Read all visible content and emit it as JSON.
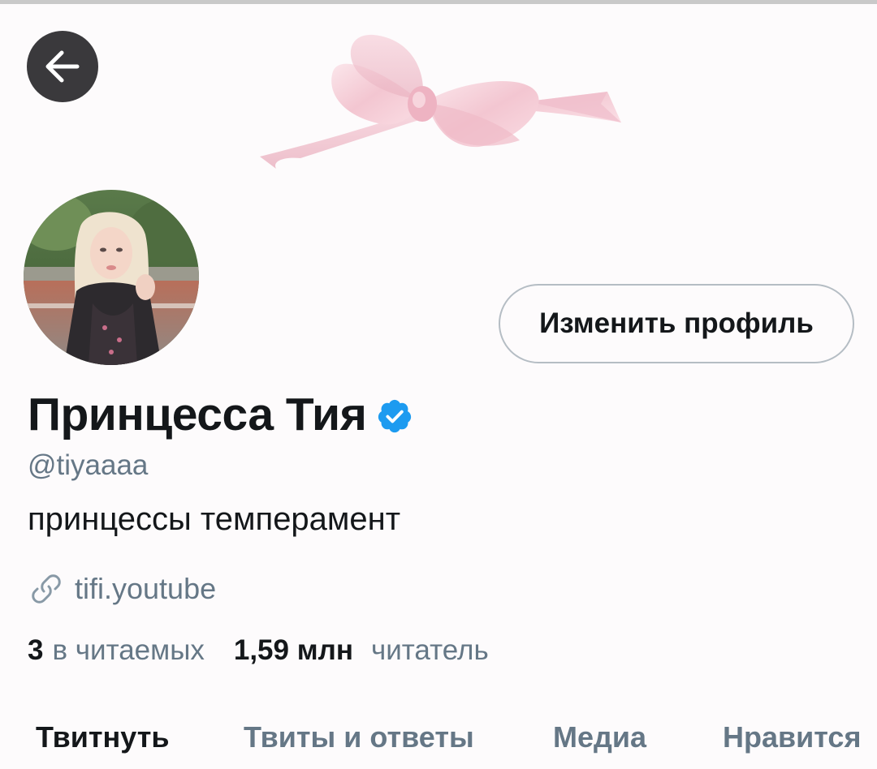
{
  "header": {
    "back_icon": "arrow-left-icon"
  },
  "profile": {
    "display_name": "Принцесса Тия",
    "verified_icon": "verified-badge-icon",
    "handle": "@tiyaaaa",
    "bio": "принцессы темперамент",
    "link_icon": "link-icon",
    "link": "tifi.youtube",
    "edit_button_label": "Изменить профиль"
  },
  "stats": {
    "following_count": "3",
    "following_label": "в читаемых",
    "followers_count": "1,59 млн",
    "followers_label": "читатель"
  },
  "tabs": [
    {
      "label": "Твитнуть",
      "active": true
    },
    {
      "label": "Твиты и ответы",
      "active": false
    },
    {
      "label": "Медиа",
      "active": false
    },
    {
      "label": "Нравится",
      "active": false
    }
  ],
  "colors": {
    "accent_blue": "#1d9bf0",
    "secondary_text": "#657786",
    "primary_text": "#14171a",
    "bow_pink": "#f5cfd8"
  }
}
